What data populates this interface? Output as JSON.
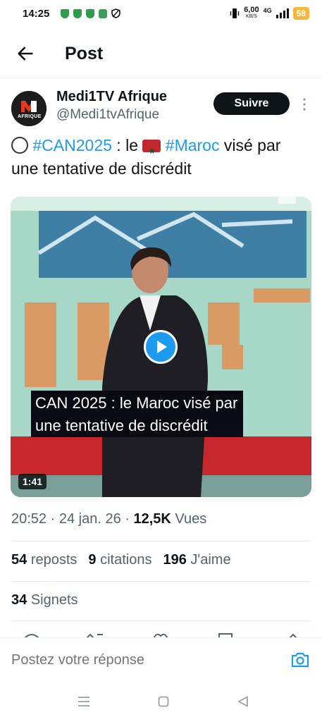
{
  "status_bar": {
    "time": "14:25",
    "net_speed": "6,00",
    "net_unit": "KB/S",
    "network": "4G",
    "battery": "58"
  },
  "header": {
    "title": "Post"
  },
  "author": {
    "name": "Medi1TV Afrique",
    "handle": "@Medi1tvAfrique",
    "avatar_text": "AFRIQUE",
    "follow_label": "Suivre"
  },
  "tweet": {
    "hashtag1": "#CAN2025",
    "text1": " : le ",
    "hashtag2": "#Maroc",
    "text2": " visé par une tentative de discrédit"
  },
  "media": {
    "caption_line1": "CAN 2025 : le Maroc visé par",
    "caption_line2": "une tentative de discrédit",
    "duration": "1:41"
  },
  "meta": {
    "time": "20:52",
    "date": "24 jan. 26",
    "views_count": "12,5K",
    "views_label": "Vues"
  },
  "stats": {
    "reposts_count": "54",
    "reposts_label": "reposts",
    "quotes_count": "9",
    "quotes_label": "citations",
    "likes_count": "196",
    "likes_label": "J'aime",
    "bookmarks_count": "34",
    "bookmarks_label": "Signets"
  },
  "reply": {
    "placeholder": "Postez votre réponse"
  },
  "colors": {
    "accent": "#1d9bf0",
    "text": "#0f1419",
    "muted": "#536471"
  }
}
